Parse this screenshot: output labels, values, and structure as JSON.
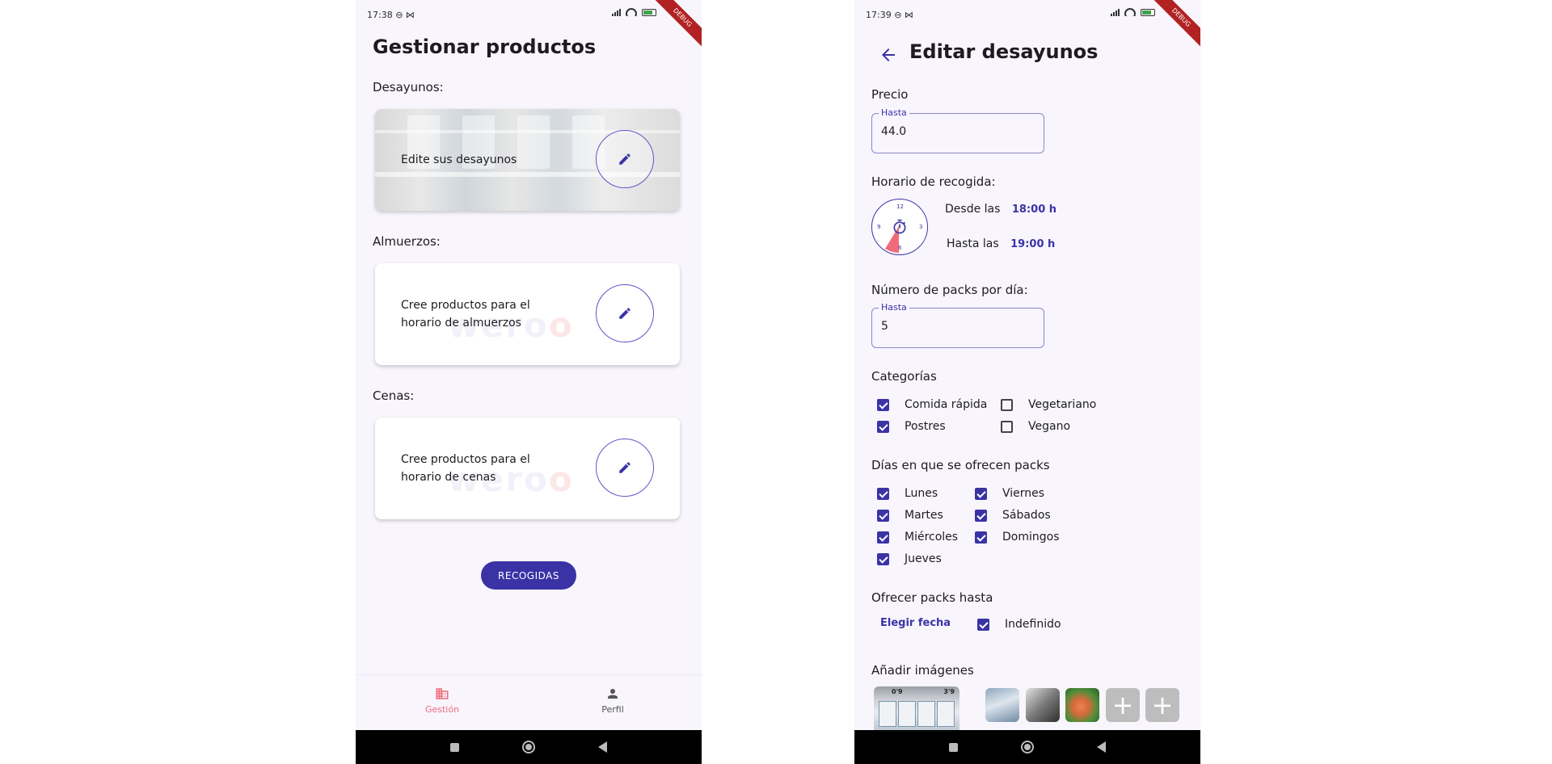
{
  "screen1": {
    "status": {
      "time": "17:38 ⊖ ⋈",
      "debug": "DEBUG"
    },
    "title": "Gestionar productos",
    "sections": [
      {
        "label": "Desayunos:",
        "card_text": "Edite sus desayunos"
      },
      {
        "label": "Almuerzos:",
        "card_text": "Cree productos para el horario de almuerzos"
      },
      {
        "label": "Cenas:",
        "card_text": "Cree productos para el horario de cenas"
      }
    ],
    "recogidas_button": "RECOGIDAS",
    "nav": [
      {
        "label": "Gestión",
        "icon": "business-icon",
        "active": true
      },
      {
        "label": "Perfil",
        "icon": "person-icon",
        "active": false
      }
    ],
    "watermark_left": "wero",
    "watermark_right": "o"
  },
  "screen2": {
    "status": {
      "time": "17:39 ⊖ ⋈",
      "debug": "DEBUG"
    },
    "title": "Editar desayunos",
    "precio": {
      "label": "Precio",
      "field_label": "Hasta",
      "value": "44.0"
    },
    "horario": {
      "label": "Horario de recogida:",
      "clock_numbers": [
        "12",
        "3",
        "6",
        "9"
      ],
      "desde_label": "Desde las",
      "desde_value": "18:00 h",
      "hasta_label": "Hasta las",
      "hasta_value": "19:00 h"
    },
    "packs": {
      "label": "Número de packs por día:",
      "field_label": "Hasta",
      "value": "5"
    },
    "categorias": {
      "label": "Categorías",
      "items": [
        {
          "label": "Comida rápida",
          "checked": true
        },
        {
          "label": "Vegetariano",
          "checked": false
        },
        {
          "label": "Postres",
          "checked": true
        },
        {
          "label": "Vegano",
          "checked": false
        }
      ]
    },
    "dias": {
      "label": "Días en que se ofrecen packs",
      "items": [
        {
          "label": "Lunes",
          "checked": true
        },
        {
          "label": "Viernes",
          "checked": true
        },
        {
          "label": "Martes",
          "checked": true
        },
        {
          "label": "Sábados",
          "checked": true
        },
        {
          "label": "Miércoles",
          "checked": true
        },
        {
          "label": "Domingos",
          "checked": true
        },
        {
          "label": "Jueves",
          "checked": true
        }
      ]
    },
    "ofrecer": {
      "label": "Ofrecer packs hasta",
      "link": "Elegir fecha",
      "indefinido": "Indefinido",
      "indefinido_checked": true
    },
    "imagenes": {
      "label": "Añadir imágenes",
      "add_symbol": "+",
      "price_tags": [
        "0'9",
        "3'9"
      ]
    }
  },
  "colors": {
    "primary": "#3a33a6",
    "accent": "#ef6b7b",
    "background": "#f8f5fd"
  }
}
